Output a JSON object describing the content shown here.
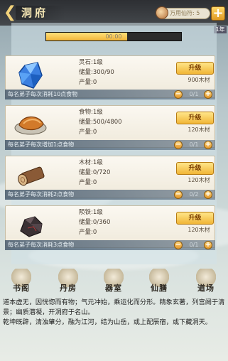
{
  "header": {
    "title": "洞府",
    "resource_text": "万用仙符: 5",
    "left_tag": "",
    "right_tag": "1年"
  },
  "progress": {
    "label": "00:00",
    "fraction": 0.6
  },
  "resources": [
    {
      "id": "lingshi",
      "name_line": "灵石:1级",
      "storage_line": "储量:300/90",
      "output_line": "产量:0",
      "upgrade_label": "升级",
      "cost": "900木材",
      "alloc_text": "每名弟子每次消耗10点食物",
      "alloc_value": "0/1"
    },
    {
      "id": "shiwu",
      "name_line": "食物:1级",
      "storage_line": "储量:500/4800",
      "output_line": "产量:0",
      "upgrade_label": "升级",
      "cost": "120木材",
      "alloc_text": "每名弟子每次增加1点食物",
      "alloc_value": "0/1"
    },
    {
      "id": "mucai",
      "name_line": "木材:1级",
      "storage_line": "储量:0/720",
      "output_line": "产量:0",
      "upgrade_label": "升级",
      "cost": "120木材",
      "alloc_text": "每名弟子每次消耗2点食物",
      "alloc_value": "0/2"
    },
    {
      "id": "yuntie",
      "name_line": "陨铁:1级",
      "storage_line": "储量:0/360",
      "output_line": "产量:0",
      "upgrade_label": "升级",
      "cost": "120木材",
      "alloc_text": "每名弟子每次消耗3点食物",
      "alloc_value": "0/1"
    }
  ],
  "bottom_nav": [
    {
      "label": "书阁"
    },
    {
      "label": "丹房"
    },
    {
      "label": "器室"
    },
    {
      "label": "仙膳"
    },
    {
      "label": "道场"
    }
  ],
  "description": [
    "道本虚无，因恍惚而有物；气元冲始，乘运化而分形。精象玄著，列宫阙于清景；幽质潜凝，开洞府于名山。",
    "乾坤既辟，清浊肇分，融为江河，结为山岳，或上配辰宿，或下藏洞天。"
  ],
  "colors": {
    "accent_gold": "#f1b536",
    "topbar": "#2d2f33"
  }
}
